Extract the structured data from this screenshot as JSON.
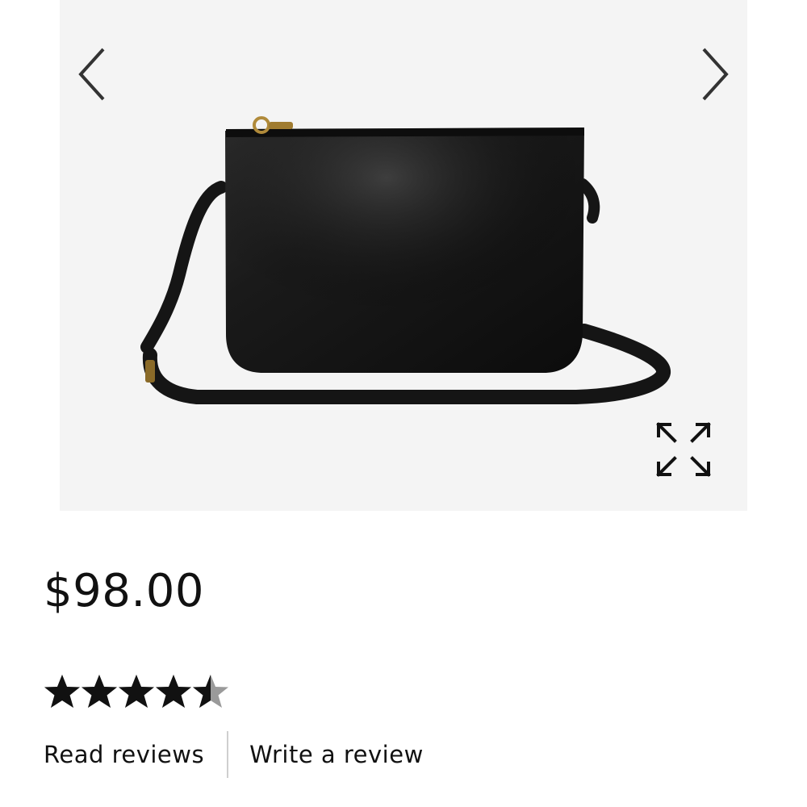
{
  "product": {
    "price": "$98.00",
    "rating": 4.5,
    "rating_max": 5
  },
  "gallery": {
    "prev_icon": "chevron-left-icon",
    "next_icon": "chevron-right-icon",
    "expand_icon": "expand-arrows-icon"
  },
  "reviews": {
    "read_label": "Read reviews",
    "write_label": "Write a review"
  },
  "colors": {
    "text": "#111111",
    "star_filled": "#111111",
    "star_empty": "#9a9a9a",
    "divider": "#cfcfcf",
    "image_background": "#f4f4f4"
  }
}
